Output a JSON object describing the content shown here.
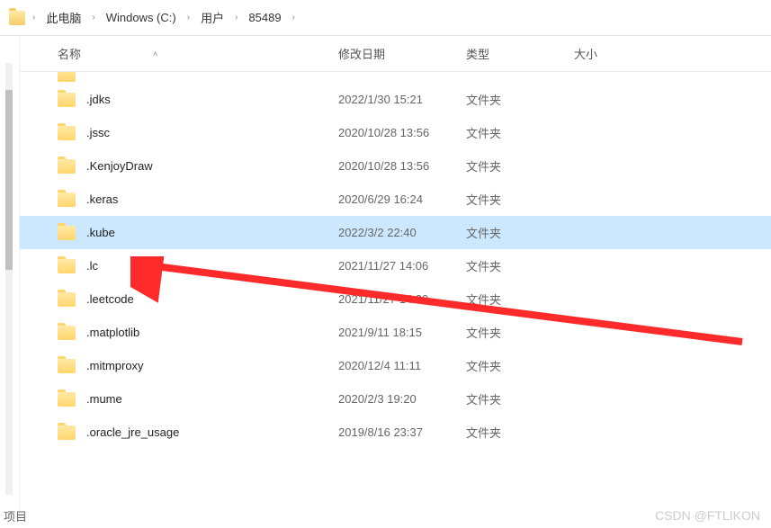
{
  "breadcrumb": {
    "items": [
      "此电脑",
      "Windows (C:)",
      "用户",
      "85489"
    ]
  },
  "headers": {
    "name": "名称",
    "date": "修改日期",
    "type": "类型",
    "size": "大小"
  },
  "files": [
    {
      "name": ".jdks",
      "date": "2022/1/30 15:21",
      "type": "文件夹",
      "selected": false
    },
    {
      "name": ".jssc",
      "date": "2020/10/28 13:56",
      "type": "文件夹",
      "selected": false
    },
    {
      "name": ".KenjoyDraw",
      "date": "2020/10/28 13:56",
      "type": "文件夹",
      "selected": false
    },
    {
      "name": ".keras",
      "date": "2020/6/29 16:24",
      "type": "文件夹",
      "selected": false
    },
    {
      "name": ".kube",
      "date": "2022/3/2 22:40",
      "type": "文件夹",
      "selected": true
    },
    {
      "name": ".lc",
      "date": "2021/11/27 14:06",
      "type": "文件夹",
      "selected": false
    },
    {
      "name": ".leetcode",
      "date": "2021/11/27 14:20",
      "type": "文件夹",
      "selected": false
    },
    {
      "name": ".matplotlib",
      "date": "2021/9/11 18:15",
      "type": "文件夹",
      "selected": false
    },
    {
      "name": ".mitmproxy",
      "date": "2020/12/4 11:11",
      "type": "文件夹",
      "selected": false
    },
    {
      "name": ".mume",
      "date": "2020/2/3 19:20",
      "type": "文件夹",
      "selected": false
    },
    {
      "name": ".oracle_jre_usage",
      "date": "2019/8/16 23:37",
      "type": "文件夹",
      "selected": false
    }
  ],
  "footer": {
    "label": "项目"
  },
  "watermark": "CSDN @FTLIKON"
}
